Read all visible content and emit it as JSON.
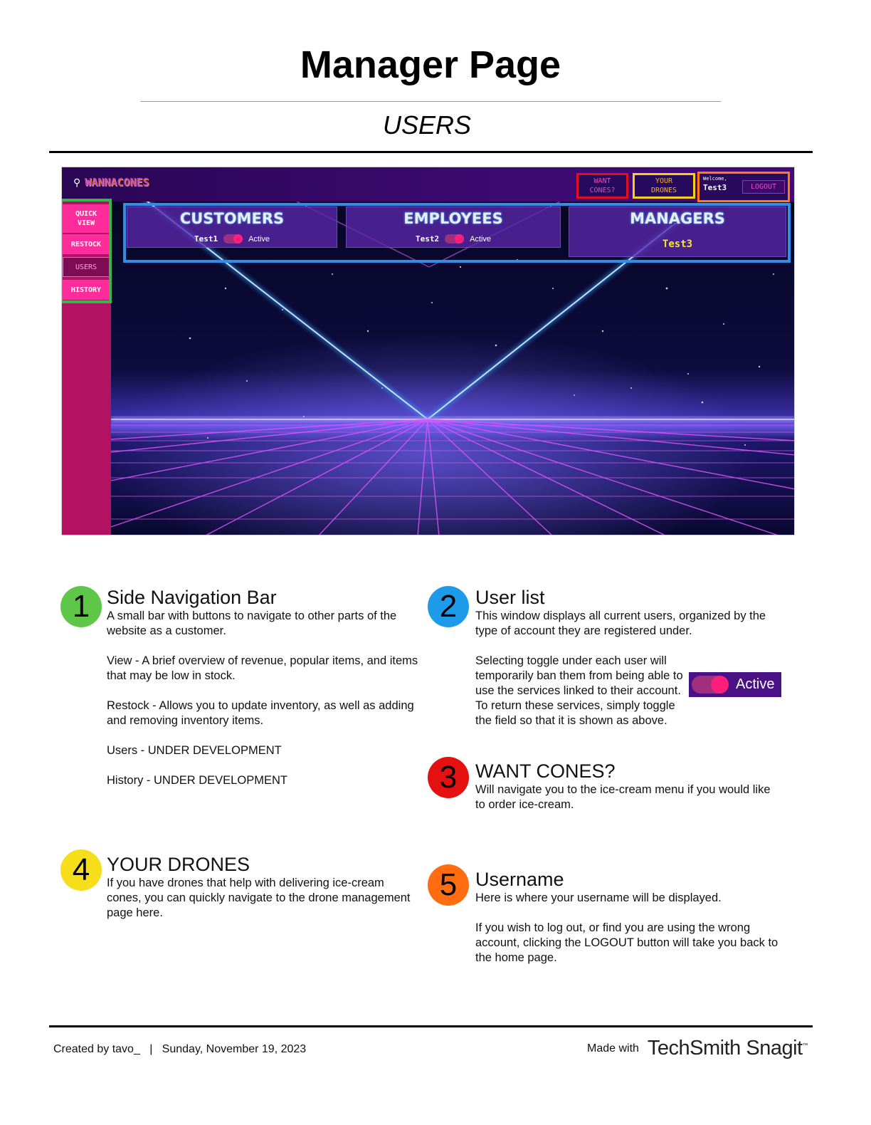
{
  "doc": {
    "title": "Manager Page",
    "subtitle": "USERS"
  },
  "screenshot": {
    "logo_icon": "ice-cream-cone-icon",
    "logo_text": "WANNACONES",
    "header": {
      "want_cones_line1": "WANT",
      "want_cones_line2": "CONES?",
      "your_drones_line1": "YOUR",
      "your_drones_line2": "DRONES",
      "welcome_label": "Welcome,",
      "username": "Test3",
      "logout_label": "LOGOUT"
    },
    "sidebar": {
      "items": [
        {
          "line1": "QUICK",
          "line2": "VIEW"
        },
        {
          "line1": "RESTOCK",
          "line2": ""
        },
        {
          "line1": "USERS",
          "line2": ""
        },
        {
          "line1": "HISTORY",
          "line2": ""
        }
      ],
      "selected": "USERS"
    },
    "cards": {
      "customers": {
        "title": "CUSTOMERS",
        "user": "Test1",
        "status": "Active",
        "toggle_on": true
      },
      "employees": {
        "title": "EMPLOYEES",
        "user": "Test2",
        "status": "Active",
        "toggle_on": true
      },
      "managers": {
        "title": "MANAGERS",
        "user": "Test3"
      }
    },
    "highlight_colors": {
      "sidebar": "#3ab54a",
      "user_list": "#2f8ee8",
      "want_cones": "#e01020",
      "your_drones": "#f5cf18",
      "username": "#ff7a10"
    }
  },
  "sections": [
    {
      "number": "1",
      "color": "#5ec747",
      "heading": "Side Navigation Bar",
      "paragraphs": [
        "A small bar with buttons to navigate to other parts of the website as a customer.",
        "View - A brief overview of revenue, popular items, and items that may be low in stock.",
        "Restock - Allows you to update inventory, as well as adding and removing inventory items.",
        "Users - UNDER DEVELOPMENT",
        "History - UNDER DEVELOPMENT"
      ]
    },
    {
      "number": "2",
      "color": "#1e9be8",
      "heading": "User list",
      "paragraphs": [
        "This window displays all current users, organized by the type of account they are registered under.",
        "Selecting toggle under each user will temporarily ban them from being able to use the services linked to their account. To return these services, simply toggle the field so that it is shown as above."
      ],
      "sample_toggle_label": "Active"
    },
    {
      "number": "3",
      "color": "#e51010",
      "heading": "WANT CONES?",
      "paragraphs": [
        "Will navigate you to the ice-cream menu if you would like to order ice-cream."
      ]
    },
    {
      "number": "4",
      "color": "#f7de1b",
      "heading": "YOUR DRONES",
      "paragraphs": [
        "If you have drones that help with delivering ice-cream cones, you can quickly navigate to the drone management page here."
      ]
    },
    {
      "number": "5",
      "color": "#ff6d10",
      "heading": "Username",
      "paragraphs": [
        "Here is where your username will be displayed.",
        "If you wish to log out, or find you are using the wrong account, clicking the LOGOUT button will take you back to the home page."
      ]
    }
  ],
  "footer": {
    "left": "Created by tavo_   |   Sunday, November 19, 2023",
    "made_with": "Made with",
    "brand": "TechSmith Snagit",
    "trademark": "™"
  }
}
